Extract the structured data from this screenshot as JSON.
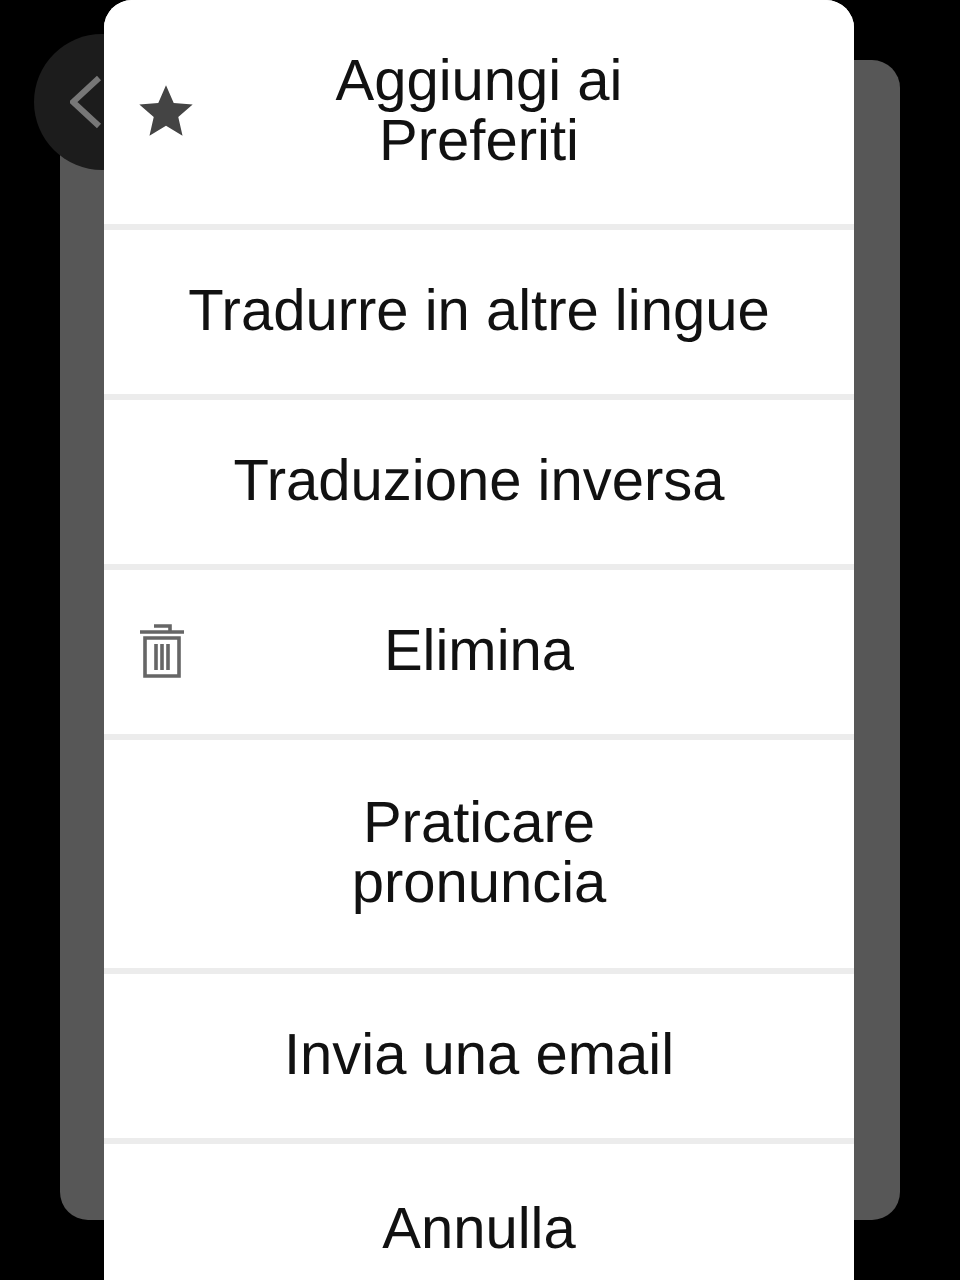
{
  "menu": {
    "items": [
      {
        "label": "Aggiungi ai\nPreferiti",
        "kind": "star"
      },
      {
        "label": "Tradurre in altre lingue",
        "kind": "plain"
      },
      {
        "label": "Traduzione inversa",
        "kind": "plain"
      },
      {
        "label": "Elimina",
        "kind": "trash"
      },
      {
        "label": "Praticare\npronuncia",
        "kind": "plain"
      },
      {
        "label": "Invia una email",
        "kind": "plain"
      },
      {
        "label": "Annulla",
        "kind": "plain"
      }
    ]
  }
}
